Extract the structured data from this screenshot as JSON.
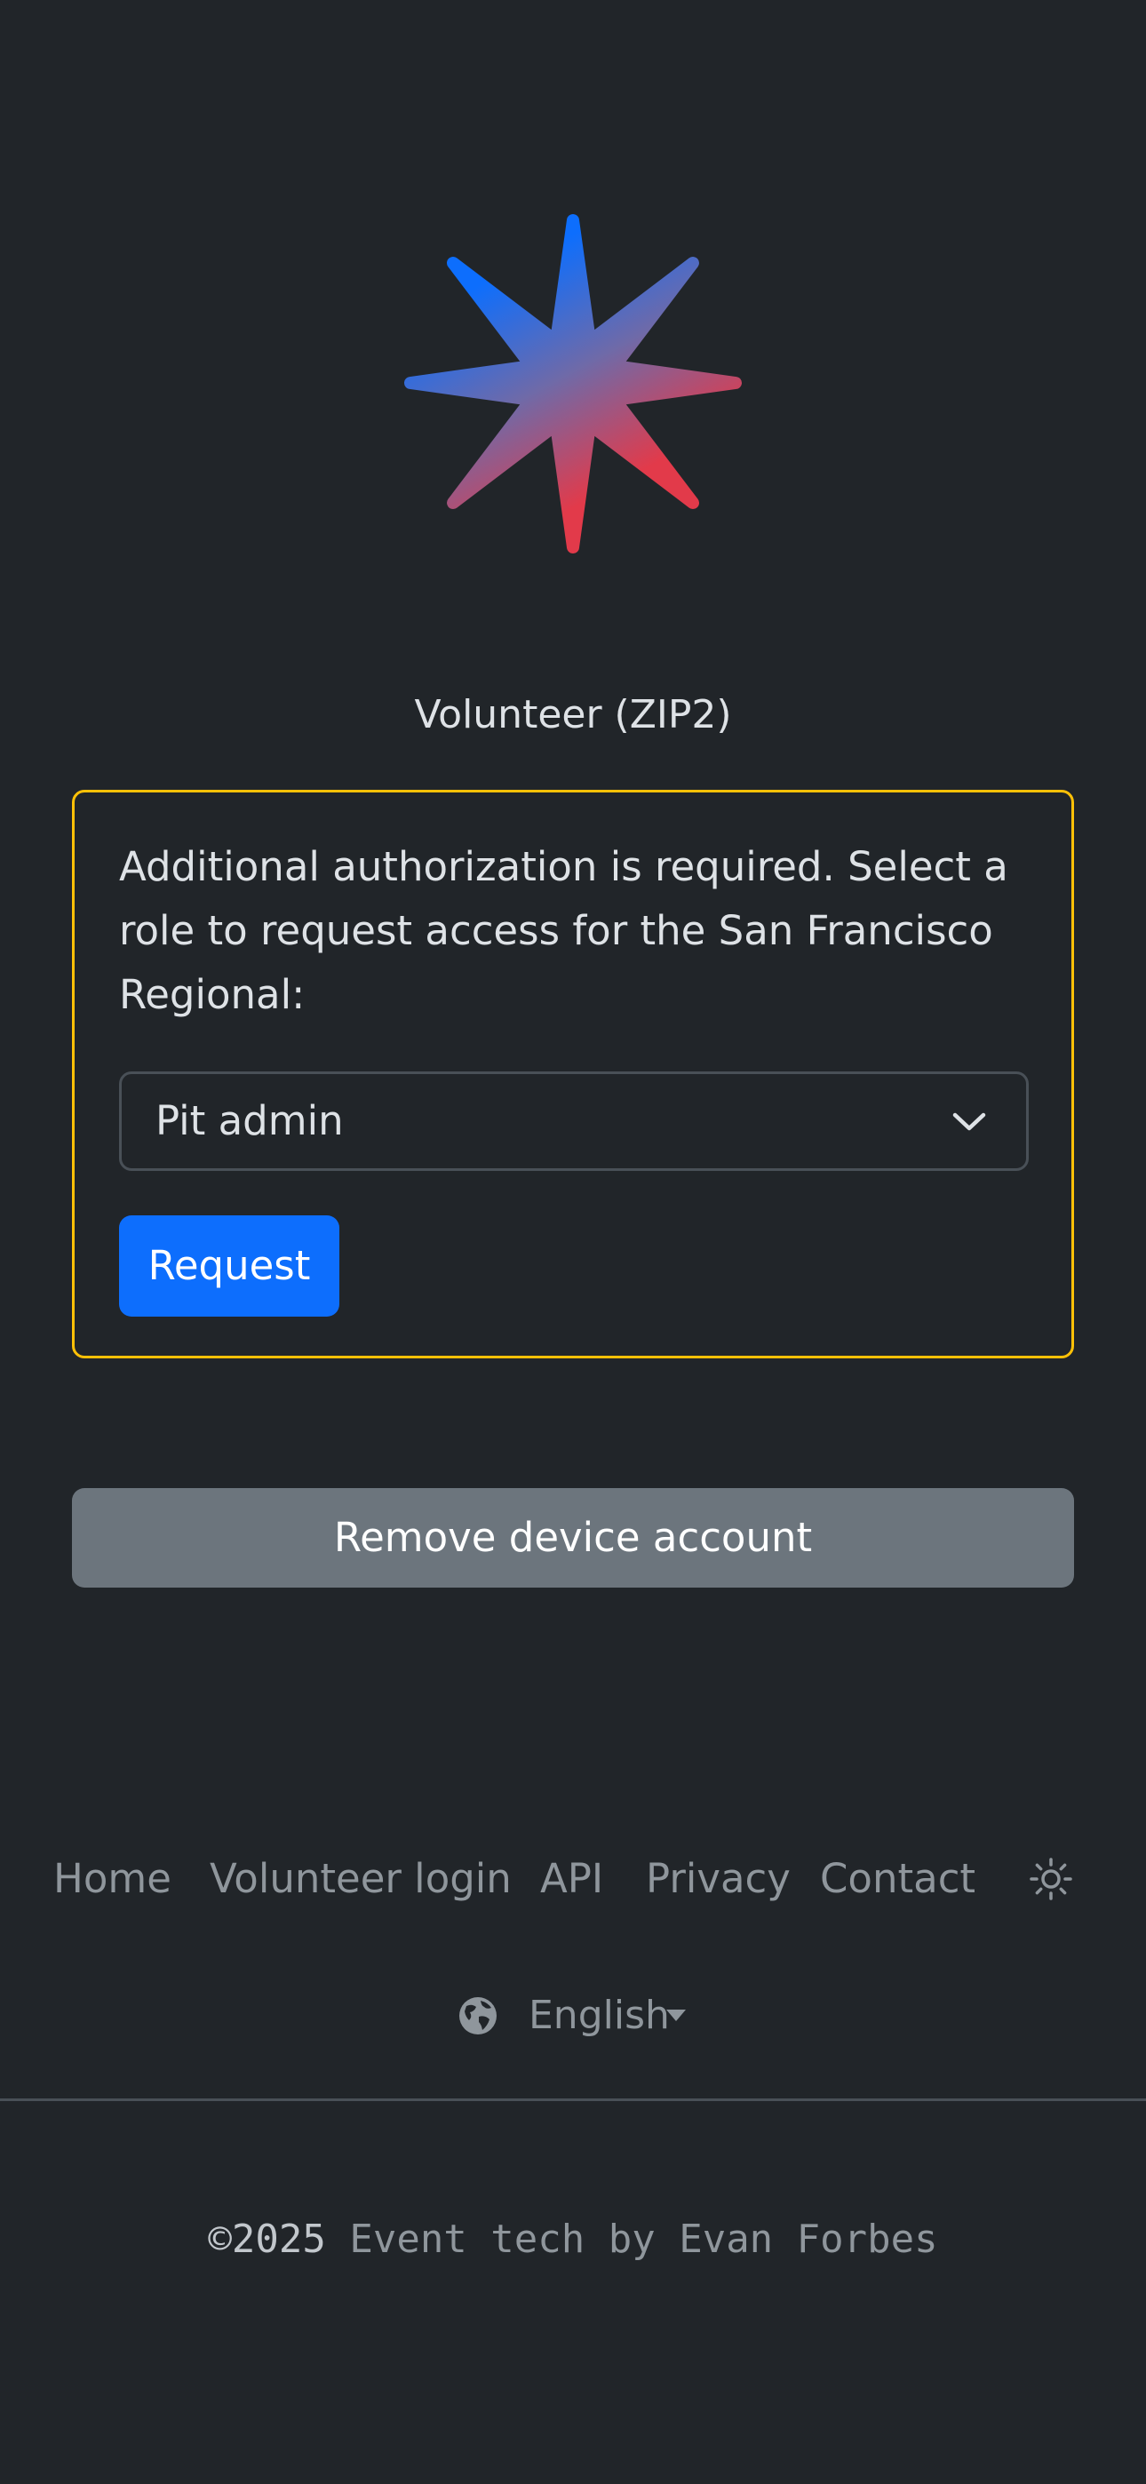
{
  "logo": {
    "icon": "gradient-star-logo",
    "gradient_start": "#0d6efd",
    "gradient_end": "#dc3545"
  },
  "device": {
    "name": "Volunteer (ZIP2)"
  },
  "auth_card": {
    "message": "Additional authorization is required. Select a role to request access for the San Francisco Regional:",
    "role_select": {
      "selected": "Pit admin"
    },
    "request_label": "Request",
    "border_color": "#ffc107"
  },
  "remove_account_label": "Remove device account",
  "footer": {
    "nav": [
      {
        "label": "Home"
      },
      {
        "label": "Volunteer login"
      },
      {
        "label": "API"
      },
      {
        "label": "Privacy"
      },
      {
        "label": "Contact"
      }
    ],
    "theme_icon": "sun-icon",
    "language": {
      "icon": "globe-icon",
      "label": "English"
    },
    "copyright_year": "©2025",
    "copyright_credit": "Event tech by Evan Forbes"
  },
  "colors": {
    "background": "#212529",
    "primary": "#0d6efd",
    "secondary": "#6c757d",
    "warning": "#ffc107"
  }
}
